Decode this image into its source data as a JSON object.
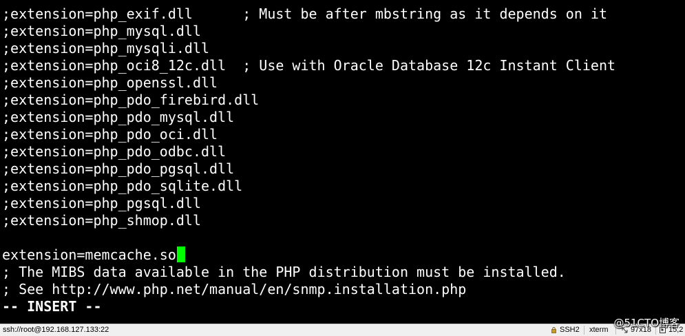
{
  "terminal": {
    "lines": [
      ";extension=php_exif.dll      ; Must be after mbstring as it depends on it",
      ";extension=php_mysql.dll",
      ";extension=php_mysqli.dll",
      ";extension=php_oci8_12c.dll  ; Use with Oracle Database 12c Instant Client",
      ";extension=php_openssl.dll",
      ";extension=php_pdo_firebird.dll",
      ";extension=php_pdo_mysql.dll",
      ";extension=php_pdo_oci.dll",
      ";extension=php_pdo_odbc.dll",
      ";extension=php_pdo_pgsql.dll",
      ";extension=php_pdo_sqlite.dll",
      ";extension=php_pgsql.dll",
      ";extension=php_shmop.dll",
      "",
      "extension=memcache.so",
      "; The MIBS data available in the PHP distribution must be installed.",
      "; See http://www.php.net/manual/en/snmp.installation.php",
      "-- INSERT --"
    ],
    "cursor_color": "#00ff00",
    "background": "#000000",
    "foreground": "#ffffff"
  },
  "statusbar": {
    "connection": "ssh://root@192.168.127.133:22",
    "protocol": "SSH2",
    "terminal_type": "xterm",
    "size": "97x18",
    "position": "15,2"
  },
  "watermark": "@51CTO博客"
}
